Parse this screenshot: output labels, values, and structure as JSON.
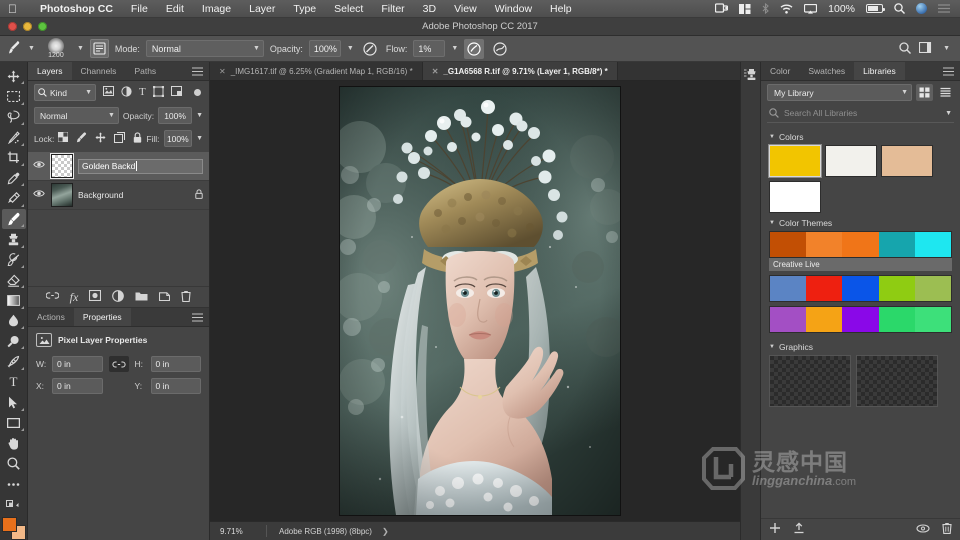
{
  "macbar": {
    "apple_icon": "apple-icon",
    "items": [
      "Photoshop CC",
      "File",
      "Edit",
      "Image",
      "Layer",
      "Type",
      "Select",
      "Filter",
      "3D",
      "View",
      "Window",
      "Help"
    ],
    "status": {
      "airdrop_icon": "airdrop-icon",
      "layout_icon": "layout-icon",
      "bluetooth_icon": "bluetooth-icon",
      "wifi_icon": "wifi-icon",
      "airplay_icon": "airplay-icon",
      "battery_percent": "100%",
      "battery_icon": "battery-charging-icon",
      "search_icon": "spotlight-search-icon",
      "user_icon": "user-avatar-icon",
      "notification_icon": "notification-center-icon"
    }
  },
  "window": {
    "title": "Adobe Photoshop CC 2017",
    "close_label": "close",
    "minimize_label": "minimize",
    "zoom_label": "zoom"
  },
  "options_bar": {
    "tool_icon": "brush-tool-icon",
    "brush_size": "1200",
    "brush_panel_icon": "brush-panel-icon",
    "mode_label": "Mode:",
    "mode_value": "Normal",
    "opacity_label": "Opacity:",
    "opacity_value": "100%",
    "opacity_pressure_icon": "pressure-opacity-icon",
    "flow_label": "Flow:",
    "flow_value": "1%",
    "airbrush_icon": "airbrush-icon",
    "smoothing_icon": "smoothing-icon",
    "search_icon": "search-icon",
    "workspace_icon": "workspace-icon"
  },
  "toolbar": {
    "tools": [
      {
        "name": "move-tool",
        "glyph": "✥",
        "active": false
      },
      {
        "name": "marquee-tool",
        "glyph": "▭",
        "active": false
      },
      {
        "name": "lasso-tool",
        "glyph": "◯",
        "active": false
      },
      {
        "name": "quick-selection-tool",
        "glyph": "✧",
        "active": false
      },
      {
        "name": "crop-tool",
        "glyph": "⌗",
        "active": false
      },
      {
        "name": "eyedropper-tool",
        "glyph": "⚲",
        "active": false
      },
      {
        "name": "healing-brush-tool",
        "glyph": "✎",
        "active": false
      },
      {
        "name": "brush-tool",
        "glyph": "✏",
        "active": true
      },
      {
        "name": "clone-stamp-tool",
        "glyph": "⎙",
        "active": false
      },
      {
        "name": "history-brush-tool",
        "glyph": "✒",
        "active": false
      },
      {
        "name": "eraser-tool",
        "glyph": "◣",
        "active": false
      },
      {
        "name": "gradient-tool",
        "glyph": "▤",
        "active": false
      },
      {
        "name": "blur-tool",
        "glyph": "💧",
        "active": false
      },
      {
        "name": "dodge-tool",
        "glyph": "🔎",
        "active": false
      },
      {
        "name": "pen-tool",
        "glyph": "✐",
        "active": false
      },
      {
        "name": "type-tool",
        "glyph": "T",
        "active": false
      },
      {
        "name": "path-selection-tool",
        "glyph": "➤",
        "active": false
      },
      {
        "name": "rectangle-tool",
        "glyph": "▬",
        "active": false
      },
      {
        "name": "hand-tool",
        "glyph": "✋",
        "active": false
      },
      {
        "name": "zoom-tool",
        "glyph": "🔍",
        "active": false
      },
      {
        "name": "edit-toolbar",
        "glyph": "⋯",
        "active": false
      }
    ],
    "foreground_color": "#e8701b",
    "background_color": "#f2b887"
  },
  "layers_panel": {
    "tabs": [
      {
        "label": "Layers",
        "active": true
      },
      {
        "label": "Channels",
        "active": false
      },
      {
        "label": "Paths",
        "active": false
      }
    ],
    "menu_icon": "panel-menu-icon",
    "filter_kind": "Kind",
    "filter_icons": [
      "pixel-filter-icon",
      "adjustment-filter-icon",
      "type-filter-icon",
      "shape-filter-icon",
      "smartobject-filter-icon"
    ],
    "blend_mode": "Normal",
    "opacity_label": "Opacity:",
    "opacity_value": "100%",
    "lock_label": "Lock:",
    "lock_icons": [
      "lock-transparency-icon",
      "lock-image-icon",
      "lock-position-icon",
      "lock-artboard-icon",
      "lock-all-icon"
    ],
    "fill_label": "Fill:",
    "fill_value": "100%",
    "layers": [
      {
        "name": "Golden Backd",
        "visible": true,
        "selected": true,
        "renaming": true,
        "thumb": "checker",
        "locked": false
      },
      {
        "name": "Background",
        "visible": true,
        "selected": false,
        "renaming": false,
        "thumb": "photo",
        "locked": true
      }
    ],
    "footer_icons": [
      "link-layers-icon",
      "layer-style-fx-icon",
      "layer-mask-icon",
      "adjustment-layer-icon",
      "new-group-icon",
      "new-layer-icon",
      "delete-layer-icon"
    ]
  },
  "properties_panel": {
    "tabs": [
      {
        "label": "Actions",
        "active": false
      },
      {
        "label": "Properties",
        "active": true
      }
    ],
    "menu_icon": "panel-menu-icon",
    "header_icon": "pixel-layer-icon",
    "header_title": "Pixel Layer Properties",
    "fields": [
      {
        "label": "W:",
        "value": "0 in",
        "name": "width-field"
      },
      {
        "label": "H:",
        "value": "0 in",
        "name": "height-field"
      },
      {
        "label": "X:",
        "value": "0 in",
        "name": "x-position-field"
      },
      {
        "label": "Y:",
        "value": "0 in",
        "name": "y-position-field"
      }
    ],
    "link_icon": "link-wh-icon"
  },
  "documents": {
    "tabs": [
      {
        "label": "_IMG1617.tif @ 6.25% (Gradient Map 1, RGB/16) *",
        "active": false
      },
      {
        "label": "_G1A6568 R.tif @ 9.71% (Layer 1, RGB/8*) *",
        "active": true
      }
    ],
    "close_icon": "close-tab-icon"
  },
  "status_bar": {
    "zoom": "9.71%",
    "info": "Adobe RGB (1998) (8bpc)",
    "expand_icon": "expand-arrow-icon"
  },
  "right_rail": {
    "icons": [
      "clone-source-panel-icon"
    ]
  },
  "libraries_panel": {
    "tabs": [
      {
        "label": "Color",
        "active": false
      },
      {
        "label": "Swatches",
        "active": false
      },
      {
        "label": "Libraries",
        "active": true
      }
    ],
    "menu_icon": "panel-menu-icon",
    "library_name": "My Library",
    "grid_view_icon": "grid-view-icon",
    "list_view_icon": "list-view-icon",
    "search_icon": "search-icon",
    "search_placeholder": "Search All Libraries",
    "search_caret_icon": "chevron-down-icon",
    "sections": [
      {
        "name": "Colors",
        "swatches": [
          {
            "hex": "#f2c500",
            "selected": true
          },
          {
            "hex": "#f2f1ec",
            "selected": false
          },
          {
            "hex": "#e4bc97",
            "selected": false
          },
          {
            "hex": "#ffffff",
            "selected": false
          }
        ]
      },
      {
        "name": "Color Themes",
        "themes": [
          {
            "label": "Creative Live",
            "colors": [
              "#c24f04",
              "#f2822a",
              "#f07518",
              "#16a5ad",
              "#1ee7f0"
            ]
          },
          {
            "label": "",
            "colors": [
              "#5b84c4",
              "#ee2010",
              "#0a55e8",
              "#8fcc12",
              "#9cbe52"
            ]
          },
          {
            "label": "",
            "colors": [
              "#a34fc4",
              "#f5a315",
              "#8a08e8",
              "#2bd86a",
              "#3de07a"
            ]
          }
        ]
      },
      {
        "name": "Graphics",
        "graphics": [
          "graphic-thumbnail-1",
          "graphic-thumbnail-2"
        ]
      }
    ],
    "footer_icons": [
      "add-content-icon",
      "upload-icon",
      "link-share-icon",
      "delete-icon"
    ]
  },
  "watermark": {
    "logo_icon": "lingganchina-logo-icon",
    "chinese": "灵感中国",
    "english": "lingganchina",
    "domain": ".com"
  }
}
